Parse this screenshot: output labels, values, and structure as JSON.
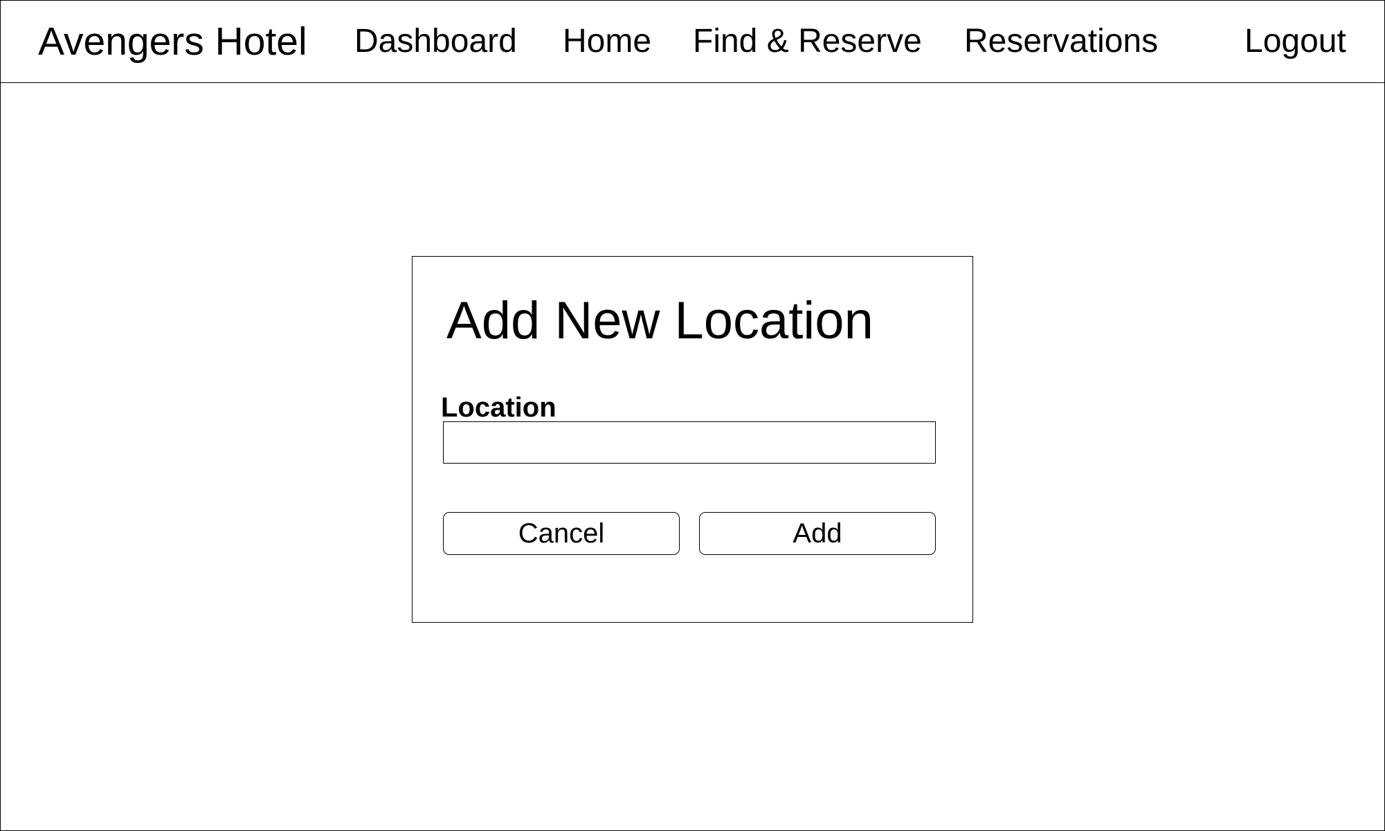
{
  "navbar": {
    "brand": "Avengers Hotel",
    "links": {
      "dashboard": "Dashboard",
      "home": "Home",
      "find_reserve": "Find & Reserve",
      "reservations": "Reservations"
    },
    "logout": "Logout"
  },
  "dialog": {
    "title": "Add New Location",
    "location_label": "Location",
    "location_value": "",
    "cancel_label": "Cancel",
    "add_label": "Add"
  }
}
